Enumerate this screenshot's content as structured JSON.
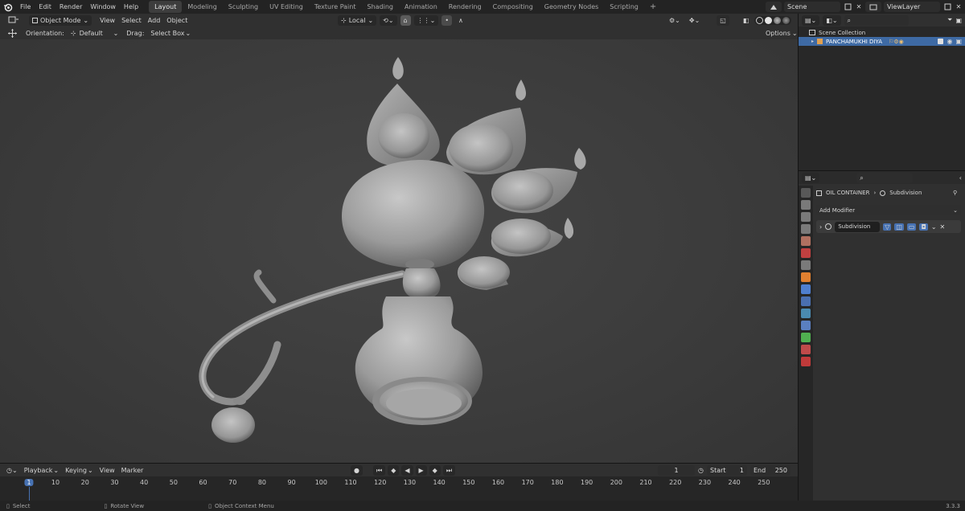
{
  "topbar": {
    "menus": [
      "File",
      "Edit",
      "Render",
      "Window",
      "Help"
    ],
    "workspaces": [
      "Layout",
      "Modeling",
      "Sculpting",
      "UV Editing",
      "Texture Paint",
      "Shading",
      "Animation",
      "Rendering",
      "Compositing",
      "Geometry Nodes",
      "Scripting"
    ],
    "active_workspace": "Layout",
    "add_workspace": "+",
    "scene": "Scene",
    "view_layer": "ViewLayer"
  },
  "viewport_header": {
    "mode": "Object Mode",
    "menus": [
      "View",
      "Select",
      "Add",
      "Object"
    ],
    "transform_space": "Local"
  },
  "tool_settings": {
    "orientation_label": "Orientation:",
    "orientation_value": "Default",
    "drag_label": "Drag:",
    "drag_value": "Select Box",
    "options": "Options"
  },
  "outliner": {
    "collection": "Scene Collection",
    "object": "PANCHAMUKHI DIYA"
  },
  "properties": {
    "object_name": "OIL CONTAINER",
    "modifier_crumb": "Subdivision",
    "add_modifier": "Add Modifier",
    "modifier_name": "Subdivision"
  },
  "timeline": {
    "menus": [
      "Playback",
      "Keying",
      "View",
      "Marker"
    ],
    "current_frame": "1",
    "start_label": "Start",
    "start_value": "1",
    "end_label": "End",
    "end_value": "250",
    "ruler": [
      "1",
      "10",
      "20",
      "30",
      "40",
      "50",
      "60",
      "70",
      "80",
      "90",
      "100",
      "110",
      "120",
      "130",
      "140",
      "150",
      "160",
      "170",
      "180",
      "190",
      "200",
      "210",
      "220",
      "230",
      "240",
      "250"
    ]
  },
  "statusbar": {
    "select": "Select",
    "rotate": "Rotate View",
    "context": "Object Context Menu",
    "version": "3.3.3"
  },
  "colors": {
    "selection_blue": "#3e6aa4",
    "frame_marker": "#4772b3",
    "model_gray": "#9a9a9a"
  }
}
